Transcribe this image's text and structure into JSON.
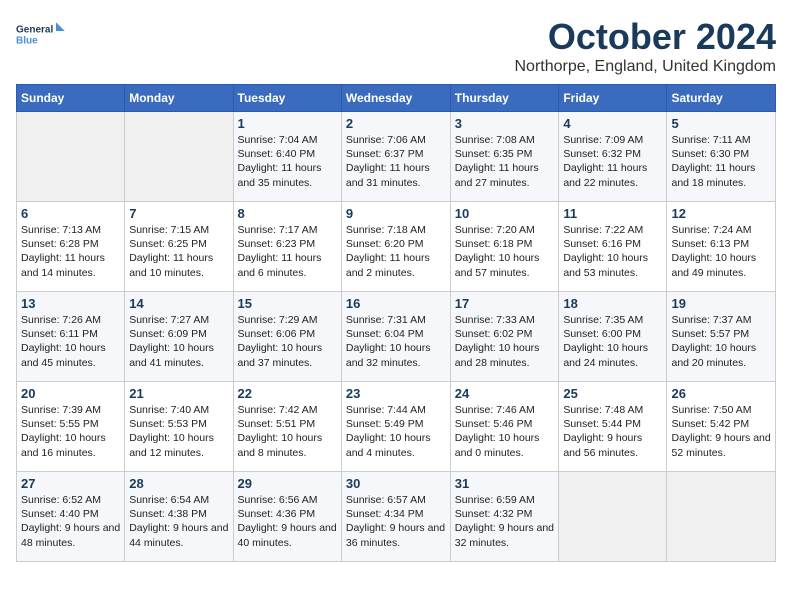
{
  "header": {
    "logo_line1": "General",
    "logo_line2": "Blue",
    "month": "October 2024",
    "location": "Northorpe, England, United Kingdom"
  },
  "weekdays": [
    "Sunday",
    "Monday",
    "Tuesday",
    "Wednesday",
    "Thursday",
    "Friday",
    "Saturday"
  ],
  "weeks": [
    [
      {
        "day": "",
        "sunrise": "",
        "sunset": "",
        "daylight": ""
      },
      {
        "day": "",
        "sunrise": "",
        "sunset": "",
        "daylight": ""
      },
      {
        "day": "1",
        "sunrise": "Sunrise: 7:04 AM",
        "sunset": "Sunset: 6:40 PM",
        "daylight": "Daylight: 11 hours and 35 minutes."
      },
      {
        "day": "2",
        "sunrise": "Sunrise: 7:06 AM",
        "sunset": "Sunset: 6:37 PM",
        "daylight": "Daylight: 11 hours and 31 minutes."
      },
      {
        "day": "3",
        "sunrise": "Sunrise: 7:08 AM",
        "sunset": "Sunset: 6:35 PM",
        "daylight": "Daylight: 11 hours and 27 minutes."
      },
      {
        "day": "4",
        "sunrise": "Sunrise: 7:09 AM",
        "sunset": "Sunset: 6:32 PM",
        "daylight": "Daylight: 11 hours and 22 minutes."
      },
      {
        "day": "5",
        "sunrise": "Sunrise: 7:11 AM",
        "sunset": "Sunset: 6:30 PM",
        "daylight": "Daylight: 11 hours and 18 minutes."
      }
    ],
    [
      {
        "day": "6",
        "sunrise": "Sunrise: 7:13 AM",
        "sunset": "Sunset: 6:28 PM",
        "daylight": "Daylight: 11 hours and 14 minutes."
      },
      {
        "day": "7",
        "sunrise": "Sunrise: 7:15 AM",
        "sunset": "Sunset: 6:25 PM",
        "daylight": "Daylight: 11 hours and 10 minutes."
      },
      {
        "day": "8",
        "sunrise": "Sunrise: 7:17 AM",
        "sunset": "Sunset: 6:23 PM",
        "daylight": "Daylight: 11 hours and 6 minutes."
      },
      {
        "day": "9",
        "sunrise": "Sunrise: 7:18 AM",
        "sunset": "Sunset: 6:20 PM",
        "daylight": "Daylight: 11 hours and 2 minutes."
      },
      {
        "day": "10",
        "sunrise": "Sunrise: 7:20 AM",
        "sunset": "Sunset: 6:18 PM",
        "daylight": "Daylight: 10 hours and 57 minutes."
      },
      {
        "day": "11",
        "sunrise": "Sunrise: 7:22 AM",
        "sunset": "Sunset: 6:16 PM",
        "daylight": "Daylight: 10 hours and 53 minutes."
      },
      {
        "day": "12",
        "sunrise": "Sunrise: 7:24 AM",
        "sunset": "Sunset: 6:13 PM",
        "daylight": "Daylight: 10 hours and 49 minutes."
      }
    ],
    [
      {
        "day": "13",
        "sunrise": "Sunrise: 7:26 AM",
        "sunset": "Sunset: 6:11 PM",
        "daylight": "Daylight: 10 hours and 45 minutes."
      },
      {
        "day": "14",
        "sunrise": "Sunrise: 7:27 AM",
        "sunset": "Sunset: 6:09 PM",
        "daylight": "Daylight: 10 hours and 41 minutes."
      },
      {
        "day": "15",
        "sunrise": "Sunrise: 7:29 AM",
        "sunset": "Sunset: 6:06 PM",
        "daylight": "Daylight: 10 hours and 37 minutes."
      },
      {
        "day": "16",
        "sunrise": "Sunrise: 7:31 AM",
        "sunset": "Sunset: 6:04 PM",
        "daylight": "Daylight: 10 hours and 32 minutes."
      },
      {
        "day": "17",
        "sunrise": "Sunrise: 7:33 AM",
        "sunset": "Sunset: 6:02 PM",
        "daylight": "Daylight: 10 hours and 28 minutes."
      },
      {
        "day": "18",
        "sunrise": "Sunrise: 7:35 AM",
        "sunset": "Sunset: 6:00 PM",
        "daylight": "Daylight: 10 hours and 24 minutes."
      },
      {
        "day": "19",
        "sunrise": "Sunrise: 7:37 AM",
        "sunset": "Sunset: 5:57 PM",
        "daylight": "Daylight: 10 hours and 20 minutes."
      }
    ],
    [
      {
        "day": "20",
        "sunrise": "Sunrise: 7:39 AM",
        "sunset": "Sunset: 5:55 PM",
        "daylight": "Daylight: 10 hours and 16 minutes."
      },
      {
        "day": "21",
        "sunrise": "Sunrise: 7:40 AM",
        "sunset": "Sunset: 5:53 PM",
        "daylight": "Daylight: 10 hours and 12 minutes."
      },
      {
        "day": "22",
        "sunrise": "Sunrise: 7:42 AM",
        "sunset": "Sunset: 5:51 PM",
        "daylight": "Daylight: 10 hours and 8 minutes."
      },
      {
        "day": "23",
        "sunrise": "Sunrise: 7:44 AM",
        "sunset": "Sunset: 5:49 PM",
        "daylight": "Daylight: 10 hours and 4 minutes."
      },
      {
        "day": "24",
        "sunrise": "Sunrise: 7:46 AM",
        "sunset": "Sunset: 5:46 PM",
        "daylight": "Daylight: 10 hours and 0 minutes."
      },
      {
        "day": "25",
        "sunrise": "Sunrise: 7:48 AM",
        "sunset": "Sunset: 5:44 PM",
        "daylight": "Daylight: 9 hours and 56 minutes."
      },
      {
        "day": "26",
        "sunrise": "Sunrise: 7:50 AM",
        "sunset": "Sunset: 5:42 PM",
        "daylight": "Daylight: 9 hours and 52 minutes."
      }
    ],
    [
      {
        "day": "27",
        "sunrise": "Sunrise: 6:52 AM",
        "sunset": "Sunset: 4:40 PM",
        "daylight": "Daylight: 9 hours and 48 minutes."
      },
      {
        "day": "28",
        "sunrise": "Sunrise: 6:54 AM",
        "sunset": "Sunset: 4:38 PM",
        "daylight": "Daylight: 9 hours and 44 minutes."
      },
      {
        "day": "29",
        "sunrise": "Sunrise: 6:56 AM",
        "sunset": "Sunset: 4:36 PM",
        "daylight": "Daylight: 9 hours and 40 minutes."
      },
      {
        "day": "30",
        "sunrise": "Sunrise: 6:57 AM",
        "sunset": "Sunset: 4:34 PM",
        "daylight": "Daylight: 9 hours and 36 minutes."
      },
      {
        "day": "31",
        "sunrise": "Sunrise: 6:59 AM",
        "sunset": "Sunset: 4:32 PM",
        "daylight": "Daylight: 9 hours and 32 minutes."
      },
      {
        "day": "",
        "sunrise": "",
        "sunset": "",
        "daylight": ""
      },
      {
        "day": "",
        "sunrise": "",
        "sunset": "",
        "daylight": ""
      }
    ]
  ]
}
